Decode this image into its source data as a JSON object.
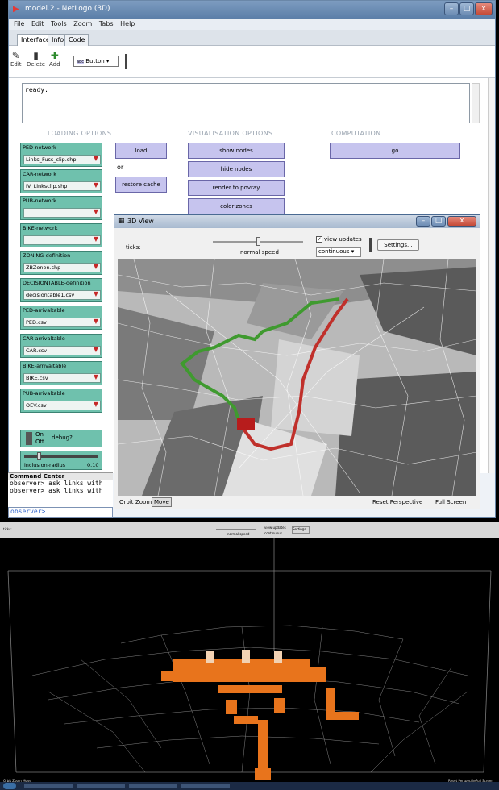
{
  "window": {
    "title": "model.2 - NetLogo (3D)"
  },
  "menu": [
    "File",
    "Edit",
    "Tools",
    "Zoom",
    "Tabs",
    "Help"
  ],
  "tabs": [
    "Interface",
    "Info",
    "Code"
  ],
  "toolbar": {
    "edit": "Edit",
    "delete": "Delete",
    "add": "Add",
    "widget_select": "Button"
  },
  "output": {
    "text": "ready."
  },
  "sections": {
    "loading": "LOADING OPTIONS",
    "visualisation": "VISUALISATION OPTIONS",
    "computation": "COMPUTATION"
  },
  "choosers": [
    {
      "label": "PED-network",
      "value": "Links_Fuss_clip.shp"
    },
    {
      "label": "CAR-network",
      "value": "IV_Linksclip.shp"
    },
    {
      "label": "PUB-network",
      "value": ""
    },
    {
      "label": "BIKE-network",
      "value": ""
    },
    {
      "label": "ZONING-definition",
      "value": "ZBZonen.shp"
    },
    {
      "label": "DECISIONTABLE-definition",
      "value": "decisiontable1.csv"
    },
    {
      "label": "PED-arrivaltable",
      "value": "PED.csv"
    },
    {
      "label": "CAR-arrivaltable",
      "value": "CAR.csv"
    },
    {
      "label": "BIKE-arrivaltable",
      "value": "BIKE.csv"
    },
    {
      "label": "PUB-arrivaltable",
      "value": "OEV.csv"
    }
  ],
  "buttons": {
    "load": "load",
    "or": "or",
    "restore_cache": "restore cache",
    "show_nodes": "show nodes",
    "hide_nodes": "hide nodes",
    "render_povray": "render to povray",
    "color_zones": "color zones",
    "go": "go"
  },
  "switch": {
    "on": "On",
    "off": "Off",
    "label": "debug?"
  },
  "slider": {
    "label": "inclusion-radius",
    "value": "0.10"
  },
  "view3d": {
    "title": "3D View",
    "ticks_label": "ticks:",
    "speed_label": "normal speed",
    "view_updates": "view updates",
    "update_mode": "continuous",
    "settings": "Settings...",
    "modes": [
      "Orbit",
      "Zoom",
      "Move"
    ],
    "reset": "Reset Perspective",
    "fullscreen": "Full Screen"
  },
  "command_center": {
    "title": "Command Center",
    "lines": [
      "observer> ask links with",
      "observer> ask links with"
    ],
    "prompt": "observer>"
  },
  "bigview": {
    "ticks_label": "ticks:",
    "speed_label": "normal speed",
    "view_updates": "view updates",
    "update_mode": "continuous",
    "settings": "Settings...",
    "bottom_left": "Orbit Zoom Move",
    "reset": "Reset Perspective",
    "fullscreen": "Full Screen"
  },
  "colors": {
    "chooser": "#6fc1ad",
    "button": "#c6c4ee",
    "path_green": "#3f9a2f",
    "path_red": "#c0302b",
    "blocks": "#e8741c"
  }
}
